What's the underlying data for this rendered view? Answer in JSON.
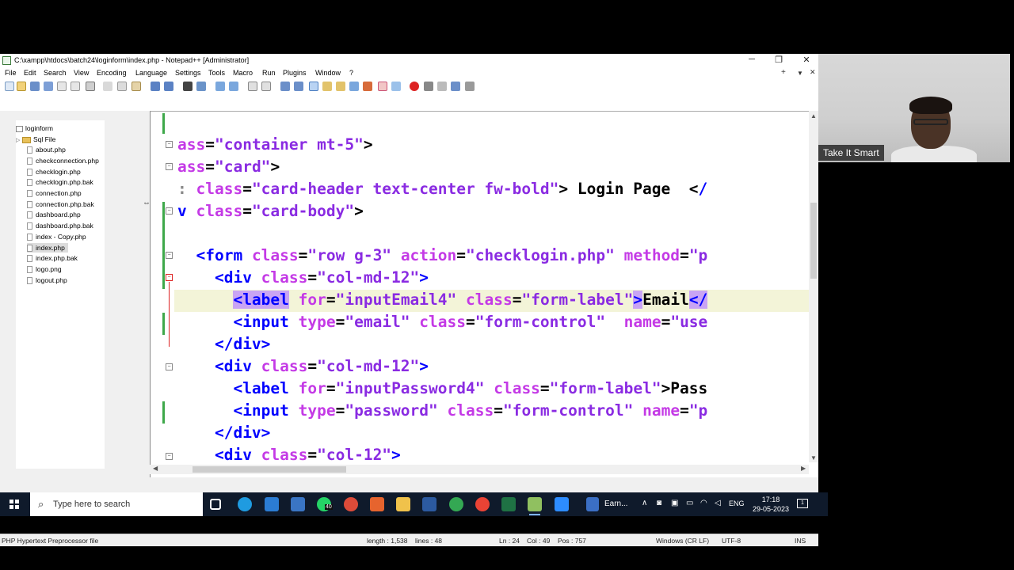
{
  "window": {
    "title": "C:\\xampp\\htdocs\\batch24\\loginform\\index.php - Notepad++ [Administrator]",
    "minimize": "─",
    "restore": "❐",
    "close": "✕"
  },
  "menu": [
    "File",
    "Edit",
    "Search",
    "View",
    "Encoding",
    "Language",
    "Settings",
    "Tools",
    "Macro",
    "Run",
    "Plugins",
    "Window",
    "?"
  ],
  "menu_right": {
    "plus": "+",
    "dropdown": "▼",
    "close": "✕"
  },
  "tree": {
    "root": "loginform",
    "folder": "Sql File",
    "files": [
      "about.php",
      "checkconnection.php",
      "checklogin.php",
      "checklogin.php.bak",
      "connection.php",
      "connection.php.bak",
      "dashboard.php",
      "dashboard.php.bak",
      "index - Copy.php",
      "index.php",
      "index.php.bak",
      "logo.png",
      "logout.php"
    ],
    "selected": "index.php"
  },
  "code": {
    "l1": {
      "a": "ass",
      "eq": "=",
      "s": "\"container mt-5\"",
      "p": ">"
    },
    "l2": {
      "a": "ass",
      "eq": "=",
      "s": "\"card\"",
      "p": ">"
    },
    "l3": {
      "pre": ": ",
      "a": "class",
      "eq": "=",
      "s": "\"card-header text-center fw-bold\"",
      "p": "> Login Page  <",
      "tail": "/"
    },
    "l4": {
      "t": "v ",
      "a": "class",
      "eq": "=",
      "s": "\"card-body\"",
      "p": ">"
    },
    "l5": {
      "t": "<form ",
      "a1": "class",
      "s1": "\"row g-3\"",
      "a2": "action",
      "s2": "\"checklogin.php\"",
      "a3": "method",
      "s3": "\"p"
    },
    "l6": {
      "t": "<div ",
      "a": "class",
      "s": "\"col-md-12\"",
      "p": ">"
    },
    "l7": {
      "t": "<label",
      "a1": "for",
      "s1": "\"inputEmail4\"",
      "a2": "class",
      "s2": "\"form-label\"",
      "p1": ">",
      "txt": "Email",
      "p2": "</"
    },
    "l8": {
      "t": "<input ",
      "a1": "type",
      "s1": "\"email\"",
      "a2": "class",
      "s2": "\"form-control\"",
      "a3": "name",
      "s3": "\"use"
    },
    "l9": {
      "t": "</div>"
    },
    "l10": {
      "t": "<div ",
      "a": "class",
      "s": "\"col-md-12\"",
      "p": ">"
    },
    "l11": {
      "t": "<label ",
      "a1": "for",
      "s1": "\"inputPassword4\"",
      "a2": "class",
      "s2": "\"form-label\"",
      "p": ">Pass"
    },
    "l12": {
      "t": "<input ",
      "a1": "type",
      "s1": "\"password\"",
      "a2": "class",
      "s2": "\"form-control\"",
      "a3": "name",
      "s3": "\"p"
    },
    "l13": {
      "t": "</div>"
    },
    "l14": {
      "t": "<div ",
      "a": "class",
      "s": "\"col-12\"",
      "p": ">"
    }
  },
  "status": {
    "filetype": "PHP Hypertext Preprocessor file",
    "length": "length : 1,538",
    "lines": "lines : 48",
    "ln": "Ln : 24",
    "col": "Col : 49",
    "pos": "Pos : 757",
    "eol": "Windows (CR LF)",
    "enc": "UTF-8",
    "ins": "INS"
  },
  "webcam": {
    "name": "Take It Smart"
  },
  "taskbar": {
    "search_placeholder": "Type here to search",
    "earn_label": "Earn...",
    "whatsapp_badge": "40",
    "lang": "ENG",
    "time": "17:18",
    "date": "29-05-2023",
    "notif_count": "1"
  },
  "colors": {
    "tag": "#0000ff",
    "attr": "#c43ae6",
    "string": "#8a2be2",
    "changebar": "#3ea84a",
    "taskbar": "#0f1a2b"
  }
}
